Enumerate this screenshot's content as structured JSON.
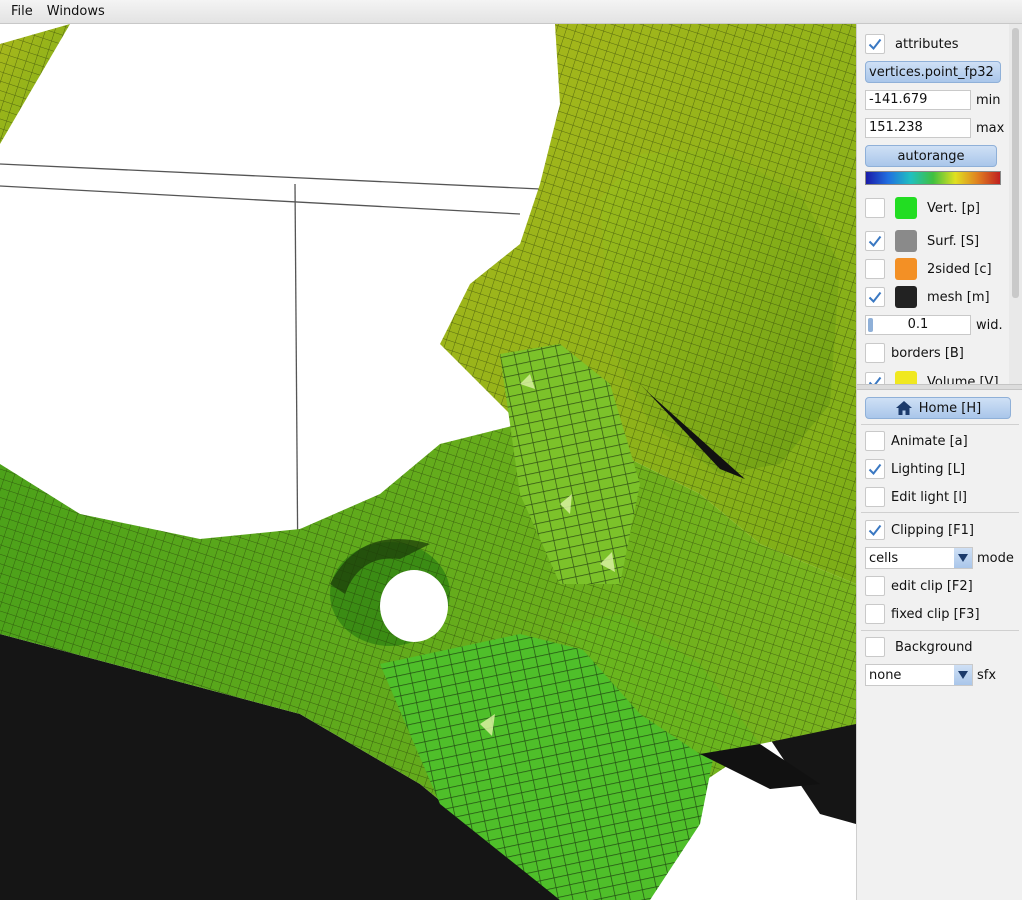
{
  "menubar": {
    "items": [
      "File",
      "Windows"
    ]
  },
  "panel": {
    "attributes": {
      "label": "attributes",
      "checked": true
    },
    "attribute_name": "vertices.point_fp32",
    "min": {
      "value": "-141.679",
      "label": "min"
    },
    "max": {
      "value": "151.238",
      "label": "max"
    },
    "autorange_label": "autorange",
    "layers": [
      {
        "label": "Vert. [p]",
        "checked": false,
        "color": "#22dd22"
      },
      {
        "label": "Surf. [S]",
        "checked": true,
        "color": "#8a8a8a"
      },
      {
        "label": "2sided [c]",
        "checked": false,
        "color": "#f39025"
      },
      {
        "label": "mesh [m]",
        "checked": true,
        "color": "#222222"
      }
    ],
    "width": {
      "value": "0.1",
      "label": "wid."
    },
    "borders": {
      "label": "borders [B]",
      "checked": false
    },
    "volume": {
      "label": "Volume [V]",
      "checked": true,
      "color": "#f0e820"
    },
    "home_label": "Home [H]",
    "animate": {
      "label": "Animate [a]",
      "checked": false
    },
    "lighting": {
      "label": "Lighting [L]",
      "checked": true
    },
    "edit_light": {
      "label": "Edit light [l]",
      "checked": false
    },
    "clipping": {
      "label": "Clipping [F1]",
      "checked": true
    },
    "clip_mode": {
      "value": "cells",
      "label": "mode"
    },
    "edit_clip": {
      "label": "edit clip [F2]",
      "checked": false
    },
    "fixed_clip": {
      "label": "fixed clip [F3]",
      "checked": false
    },
    "background": {
      "label": "Background",
      "checked": false
    },
    "sfx": {
      "value": "none",
      "label": "sfx"
    }
  },
  "icons": {
    "check": "check-icon",
    "home": "home-icon",
    "dropdown": "chevron-down-icon"
  },
  "colors": {
    "accent": "#3a78c2",
    "mesh_dark": "#3f8f10",
    "mesh_light": "#a6c21a"
  }
}
